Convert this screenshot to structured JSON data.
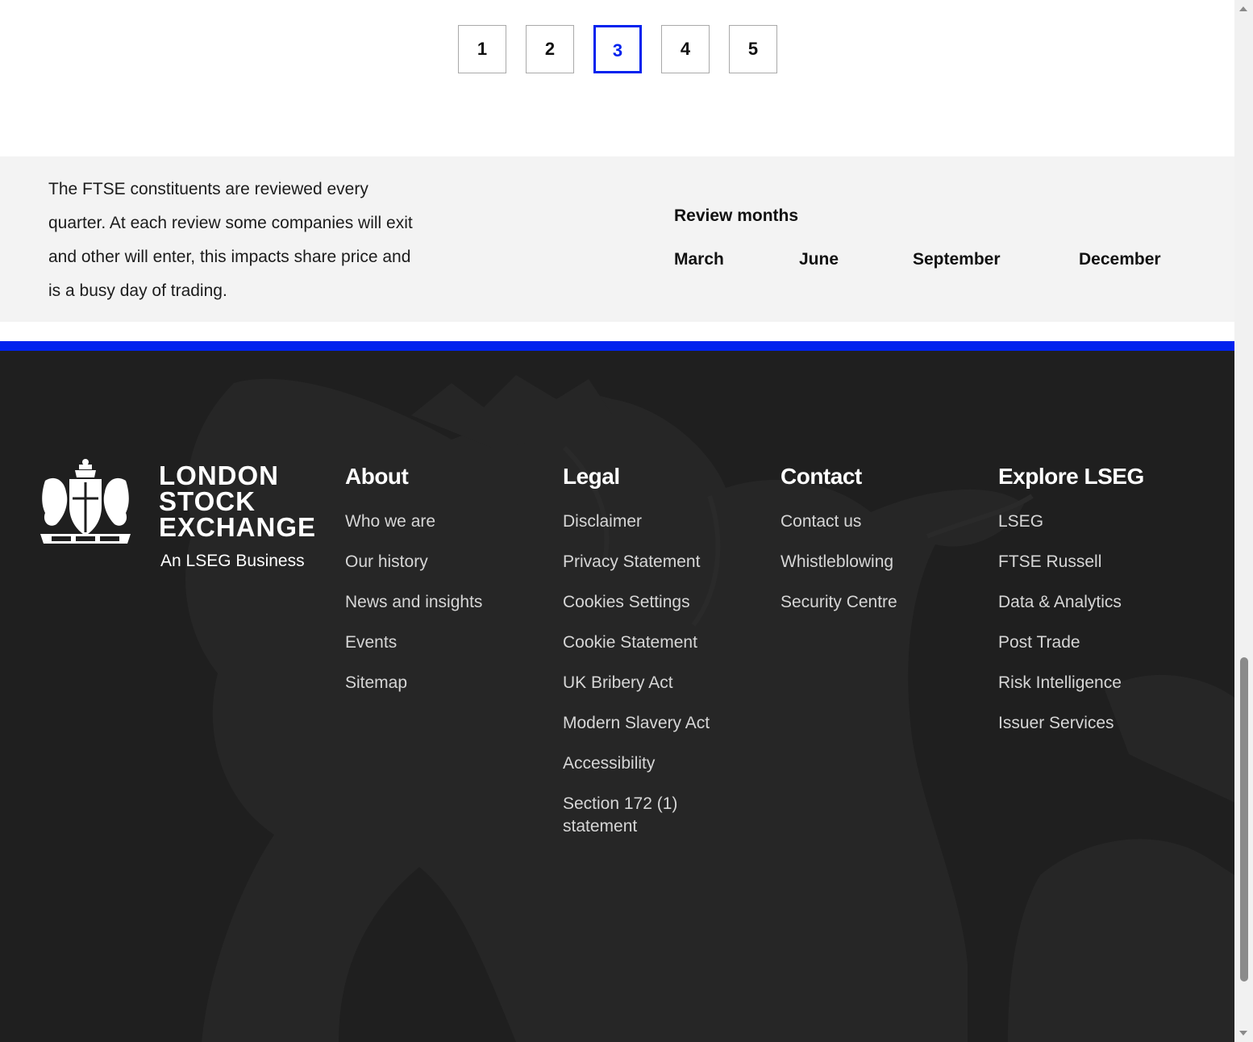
{
  "pagination": {
    "pages": [
      "1",
      "2",
      "3",
      "4",
      "5"
    ],
    "current": "3",
    "active_color": "#0022ee"
  },
  "review": {
    "description": "The FTSE constituents are reviewed every quarter. At each review some companies will exit and other will enter, this impacts share price and is a busy day of trading.",
    "heading": "Review months",
    "months": [
      "March",
      "June",
      "September",
      "December"
    ]
  },
  "footer": {
    "logo": {
      "line1": "LONDON",
      "line2": "STOCK",
      "line3": "EXCHANGE",
      "tagline": "An LSEG Business",
      "crest_motto": [
        "DICTUM",
        "MEUM",
        "PACTUM"
      ]
    },
    "columns": [
      {
        "title": "About",
        "links": [
          "Who we are",
          "Our history",
          "News and insights",
          "Events",
          "Sitemap"
        ]
      },
      {
        "title": "Legal",
        "links": [
          "Disclaimer",
          "Privacy Statement",
          "Cookies Settings",
          "Cookie Statement",
          "UK Bribery Act",
          "Modern Slavery Act",
          "Accessibility",
          "Section 172 (1) statement"
        ]
      },
      {
        "title": "Contact",
        "links": [
          "Contact us",
          "Whistleblowing",
          "Security Centre"
        ]
      },
      {
        "title": "Explore LSEG",
        "links": [
          "LSEG",
          "FTSE Russell",
          "Data & Analytics",
          "Post Trade",
          "Risk Intelligence",
          "Issuer Services"
        ]
      }
    ],
    "colors": {
      "background": "#1f1f1f",
      "accent_bar": "#0022ee",
      "link": "#d6d6d6",
      "heading": "#ffffff"
    }
  }
}
